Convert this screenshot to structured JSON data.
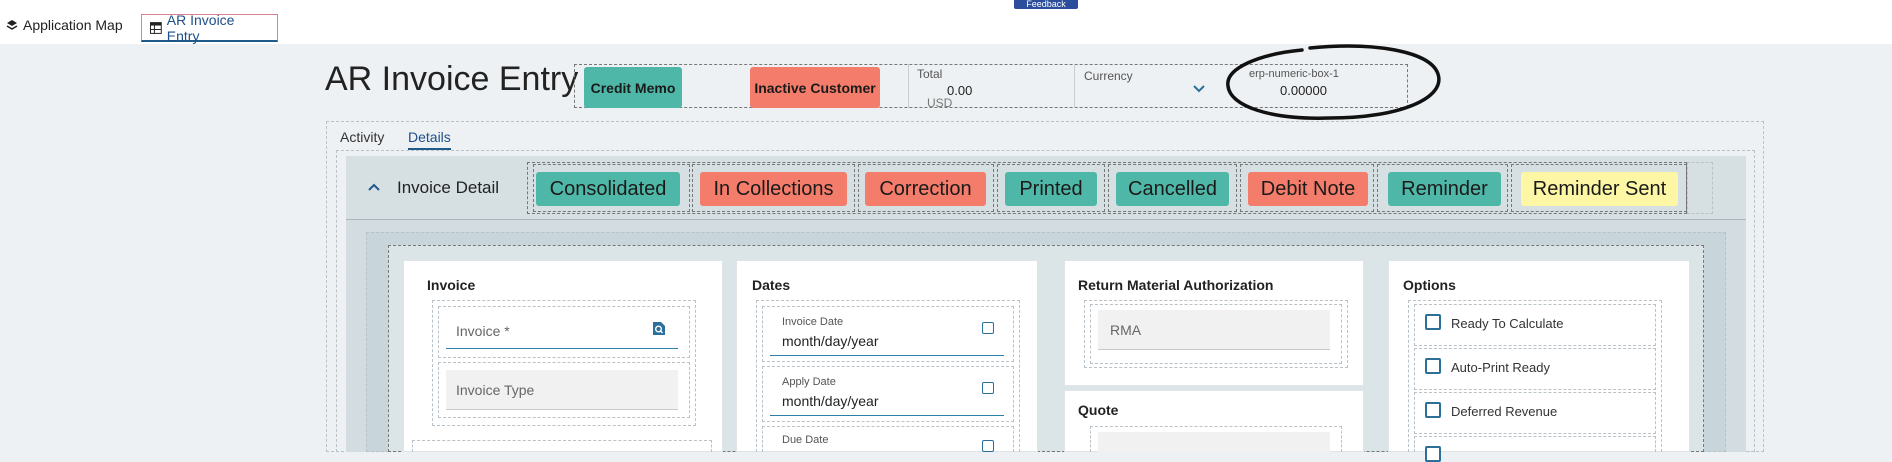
{
  "nav": {
    "tabs": [
      {
        "label": "Application Map"
      },
      {
        "label": "AR Invoice Entry"
      }
    ],
    "feedback": "Feedback"
  },
  "header": {
    "title": "AR Invoice Entry",
    "credit_memo": "Credit Memo",
    "inactive_customer": "Inactive Customer",
    "total_label": "Total",
    "total_value": "0.00",
    "total_currency": "USD",
    "currency_label": "Currency",
    "numeric_box_label": "erp-numeric-box-1",
    "numeric_box_value": "0.00000"
  },
  "page_tabs": [
    {
      "label": "Activity"
    },
    {
      "label": "Details"
    }
  ],
  "invoice_detail": {
    "title": "Invoice Detail",
    "badges": [
      {
        "label": "Consolidated",
        "color": "#4fb7a8"
      },
      {
        "label": "In Collections",
        "color": "#f47c6a"
      },
      {
        "label": "Correction",
        "color": "#f47c6a"
      },
      {
        "label": "Printed",
        "color": "#4fb7a8"
      },
      {
        "label": "Cancelled",
        "color": "#4fb7a8"
      },
      {
        "label": "Debit Note",
        "color": "#f47c6a"
      },
      {
        "label": "Reminder",
        "color": "#4fb7a8"
      },
      {
        "label": "Reminder Sent",
        "color": "#fdf6a5"
      }
    ]
  },
  "sections": {
    "invoice": {
      "title": "Invoice",
      "invoice_placeholder": "Invoice *",
      "invoice_type_placeholder": "Invoice Type"
    },
    "dates": {
      "title": "Dates",
      "invoice_date_label": "Invoice Date",
      "invoice_date_value": "month/day/year",
      "apply_date_label": "Apply Date",
      "apply_date_value": "month/day/year",
      "due_date_label": "Due Date"
    },
    "rma": {
      "title": "Return Material Authorization",
      "rma_placeholder": "RMA",
      "quote_title": "Quote"
    },
    "options": {
      "title": "Options",
      "items": [
        {
          "label": "Ready To Calculate"
        },
        {
          "label": "Auto-Print Ready"
        },
        {
          "label": "Deferred Revenue"
        }
      ]
    }
  },
  "colors": {
    "accent": "#1e5a8a",
    "green_badge": "#4fb7a8",
    "salmon_badge": "#f47c6a",
    "yellow_badge": "#fdf6a5"
  }
}
